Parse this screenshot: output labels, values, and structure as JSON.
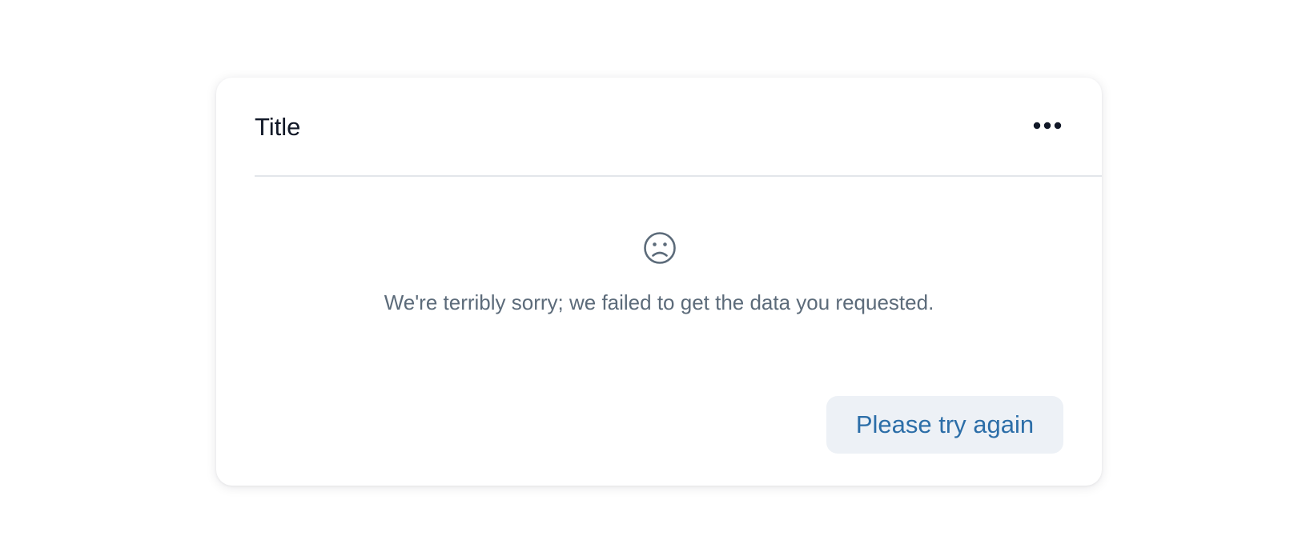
{
  "card": {
    "title": "Title",
    "menu_icon": "more-horizontal-icon",
    "status_icon": "sad-face-icon",
    "error_message": "We're terribly sorry; we failed to get the data you requested.",
    "retry_label": "Please try again"
  },
  "colors": {
    "title_text": "#111827",
    "message_text": "#5c6b7a",
    "button_background": "#edf1f6",
    "button_text": "#2c6ea8",
    "divider": "#e3e6ea"
  }
}
